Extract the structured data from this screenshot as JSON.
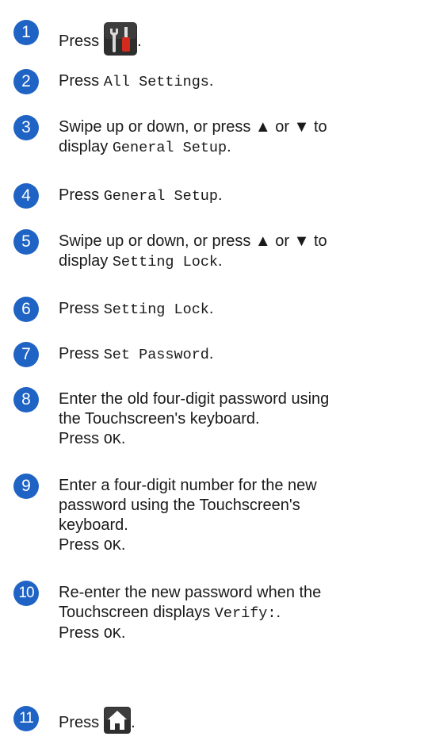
{
  "accent": "#1f63c4",
  "steps": [
    {
      "num": "1",
      "pre": "Press",
      "icon": "settings-tools-icon",
      "post": "."
    },
    {
      "num": "2",
      "pre": "Press ",
      "code": "All Settings",
      "post": "."
    },
    {
      "num": "3",
      "line1": "Swipe up or down, or press ▲ or ▼ to",
      "pre": "display ",
      "code": "General Setup",
      "post": "."
    },
    {
      "num": "4",
      "pre": "Press ",
      "code": "General Setup",
      "post": "."
    },
    {
      "num": "5",
      "line1": "Swipe up or down, or press ▲ or ▼ to",
      "pre": "display ",
      "code": "Setting Lock",
      "post": "."
    },
    {
      "num": "6",
      "pre": "Press ",
      "code": "Setting Lock",
      "post": "."
    },
    {
      "num": "7",
      "pre": "Press ",
      "code": "Set Password",
      "post": "."
    },
    {
      "num": "8",
      "line1": "Enter the old four-digit password using",
      "line2": "the Touchscreen's keyboard.",
      "pre": "Press ",
      "code": "OK",
      "post": "."
    },
    {
      "num": "9",
      "line1": "Enter a four-digit number for the new",
      "line2": "password using the Touchscreen's",
      "line3": "keyboard.",
      "pre": "Press ",
      "code": "OK",
      "post": "."
    },
    {
      "num": "10",
      "line1": "Re-enter the new password when the",
      "pre1": "Touchscreen displays ",
      "code1": "Verify:",
      "post1": ".",
      "pre": "Press ",
      "code": "OK",
      "post": "."
    },
    {
      "num": "11",
      "pre": "Press",
      "icon": "home-icon",
      "post": "."
    }
  ]
}
